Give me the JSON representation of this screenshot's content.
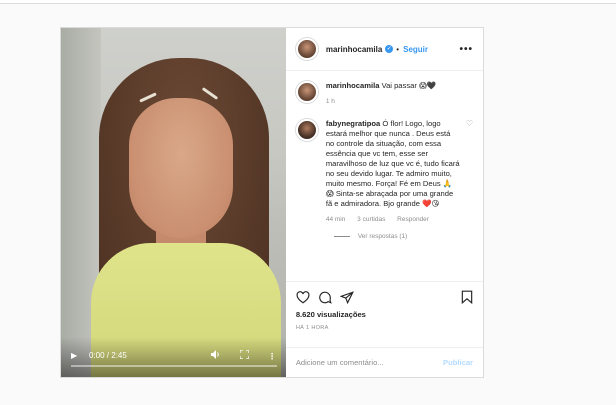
{
  "post": {
    "username": "marinhocamila",
    "follow_label": "Seguir",
    "more_label": "•••",
    "caption": {
      "username": "marinhocamila",
      "text": "Vai passar 😱🖤",
      "time": "1 h"
    },
    "comment": {
      "username": "fabynegratipoa",
      "text": "Ó flor! Logo, logo estará melhor que nunca . Deus está no controle da situação, com essa essência que vc tem, esse ser maravilhoso de luz que vc é, tudo ficará no seu devido lugar. Te admiro muito, muito mesmo. Força! Fé em Deus 🙏😱 Sinta-se abraçada por uma grande fã e admiradora. Bjo grande ❤️😘",
      "time": "44 min",
      "likes": "3 curtidas",
      "reply": "Responder",
      "view_replies": "Ver respostas (1)"
    },
    "views": "8.620 visualizações",
    "ago": "HÁ 1 HORA",
    "add_comment_placeholder": "Adicione um comentário...",
    "publish_label": "Publicar"
  },
  "video": {
    "time": "0:00 / 2:45",
    "progress": 0
  },
  "colors": {
    "accent": "#3897f0",
    "border": "#dbdbdb",
    "muted": "#8e8e8e"
  }
}
